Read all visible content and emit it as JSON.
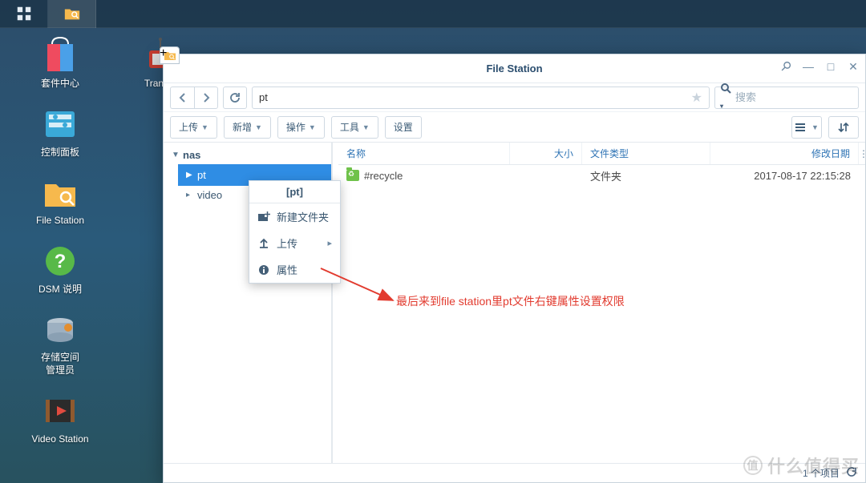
{
  "taskbar": {
    "items": [
      {
        "name": "main-menu-icon"
      },
      {
        "name": "file-station-taskbar-icon"
      }
    ]
  },
  "desktop": {
    "col1": [
      {
        "name": "package-center",
        "label": "套件中心"
      },
      {
        "name": "control-panel",
        "label": "控制面板"
      },
      {
        "name": "file-station",
        "label": "File Station"
      },
      {
        "name": "dsm-help",
        "label": "DSM 说明"
      },
      {
        "name": "storage-manager",
        "label": "存储空间\n管理员"
      },
      {
        "name": "video-station",
        "label": "Video Station"
      }
    ],
    "col2": [
      {
        "name": "transmission",
        "label": "Transm"
      }
    ]
  },
  "window": {
    "title": "File Station",
    "controls": {
      "pin": "⇲",
      "min": "—",
      "max": "□",
      "close": "✕"
    },
    "path": "pt",
    "search_placeholder": "搜索",
    "buttons": {
      "upload": "上传",
      "create": "新增",
      "action": "操作",
      "tools": "工具",
      "settings": "设置"
    },
    "tree": {
      "root": "nas",
      "children": [
        {
          "name": "pt",
          "selected": true
        },
        {
          "name": "video",
          "selected": false
        }
      ]
    },
    "list": {
      "headers": {
        "name": "名称",
        "size": "大小",
        "type": "文件类型",
        "date": "修改日期"
      },
      "rows": [
        {
          "name": "#recycle",
          "size": "",
          "type": "文件夹",
          "date": "2017-08-17 22:15:28"
        }
      ]
    },
    "status": {
      "count": "1 个项目"
    }
  },
  "context_menu": {
    "title": "[pt]",
    "items": [
      {
        "icon": "＋",
        "label": "新建文件夹",
        "submenu": false
      },
      {
        "icon": "⇧",
        "label": "上传",
        "submenu": true
      },
      {
        "icon": "ⓘ",
        "label": "属性",
        "submenu": false
      }
    ]
  },
  "annotation": "最后来到file station里pt文件右键属性设置权限",
  "watermark": "什么值得买"
}
